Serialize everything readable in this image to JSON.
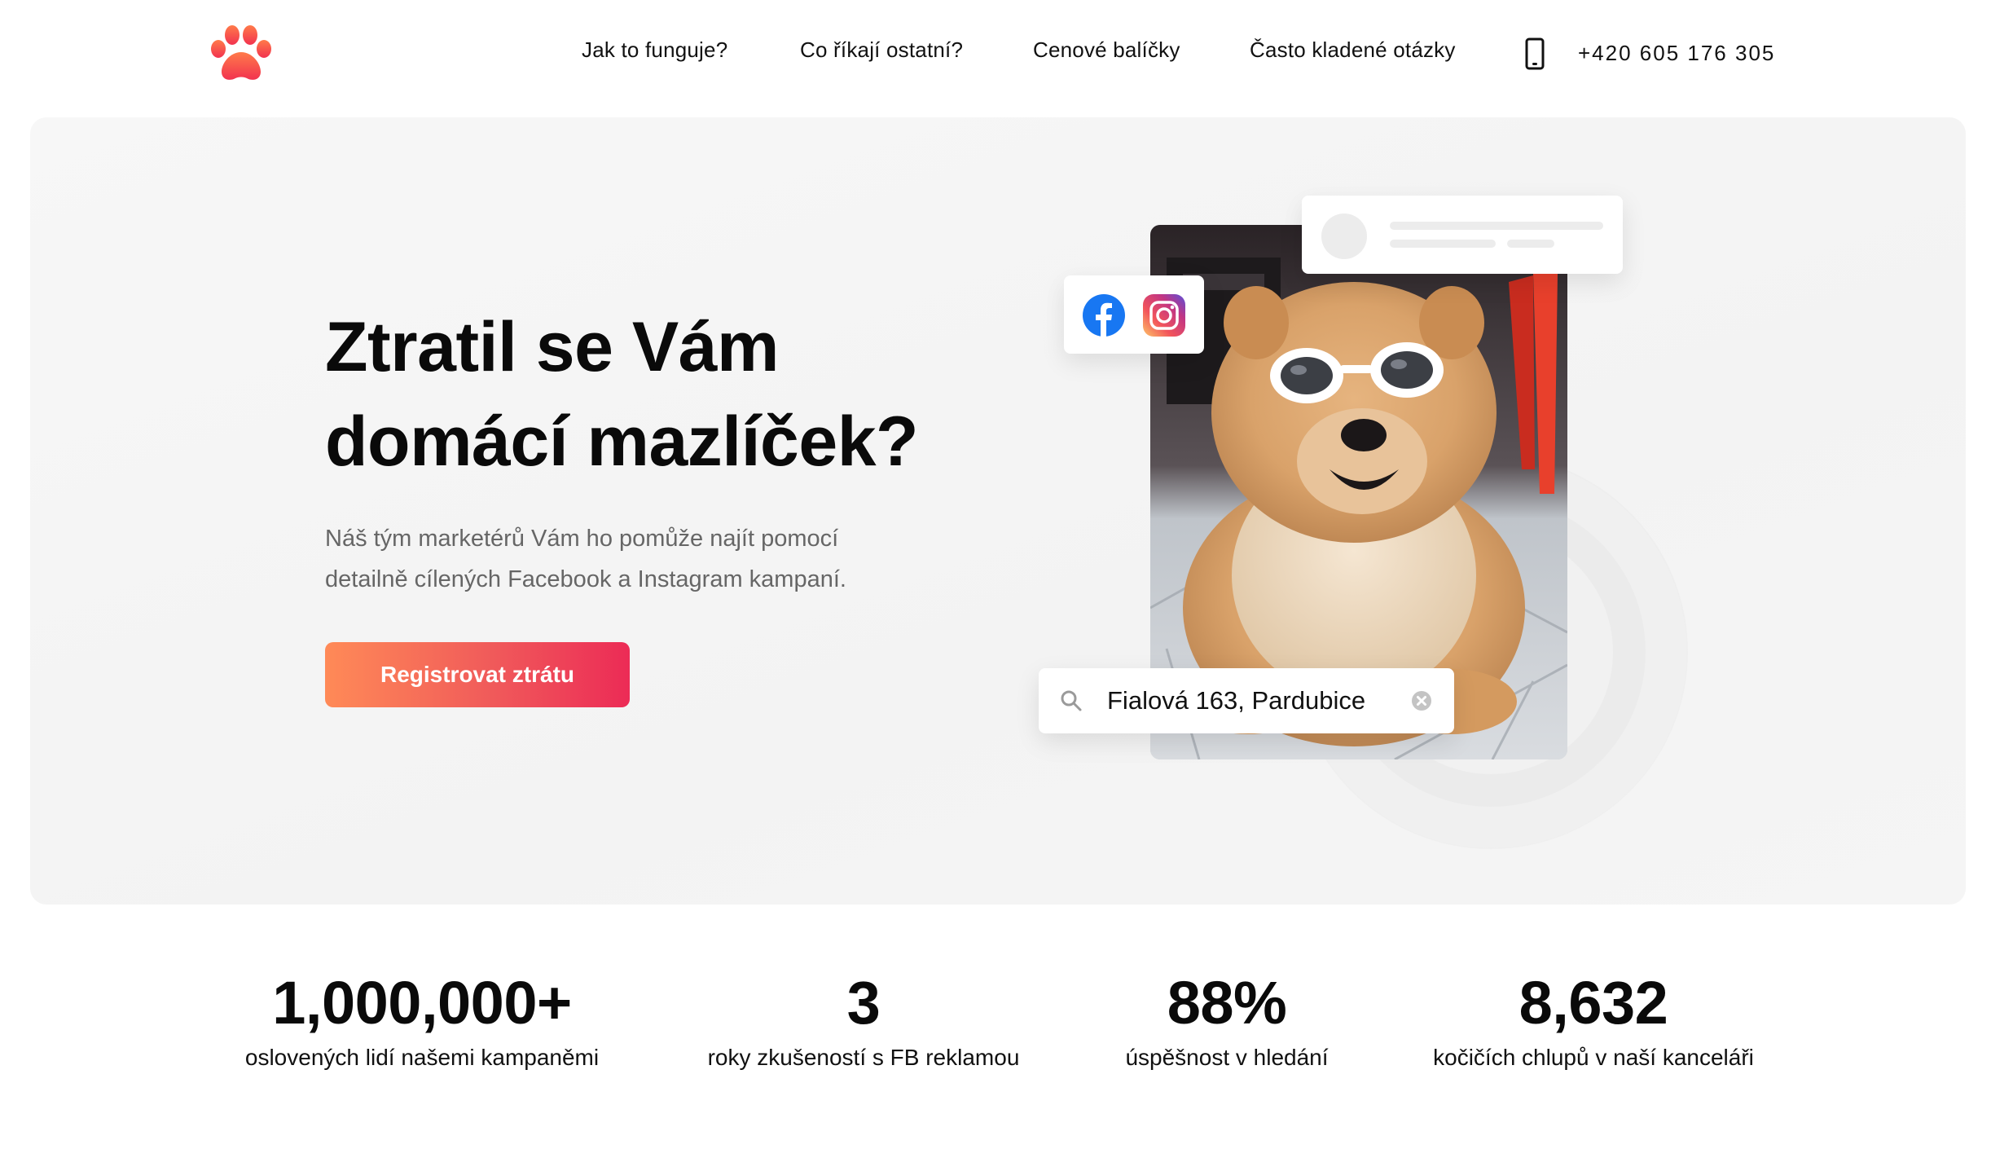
{
  "brand": {
    "logo_icon": "paw-icon",
    "accent": "#ff5a5f"
  },
  "nav": {
    "items": [
      {
        "label": "Jak to funguje?"
      },
      {
        "label": "Co říkají ostatní?"
      },
      {
        "label": "Cenové balíčky"
      },
      {
        "label": "Často kladené otázky"
      }
    ],
    "phone_icon": "smartphone-icon",
    "phone": "+420 605 176 305"
  },
  "hero": {
    "title_line1": "Ztratil se Vám",
    "title_line2": "domácí mazlíček?",
    "subtitle_line1": "Náš tým marketérů Vám ho pomůže najít pomocí",
    "subtitle_line2": "detailně cílených Facebook a Instagram kampaní.",
    "cta": "Registrovat ztrátu",
    "cta_gradient": [
      "#ff8a57",
      "#ec2b56"
    ]
  },
  "illustration": {
    "photo": "dog-with-sunglasses-photo",
    "social_icons": [
      "facebook-icon",
      "instagram-icon"
    ],
    "search_value": "Fialová 163, Pardubice",
    "search_icon": "search-icon",
    "clear_icon": "clear-icon"
  },
  "stats": [
    {
      "value": "1,000,000+",
      "label": "oslovených lidí našemi kampaněmi"
    },
    {
      "value": "3",
      "label": "roky zkušeností s FB reklamou"
    },
    {
      "value": "88%",
      "label": "úspěšnost v hledání"
    },
    {
      "value": "8,632",
      "label": "kočičích chlupů v naší kanceláři"
    }
  ]
}
